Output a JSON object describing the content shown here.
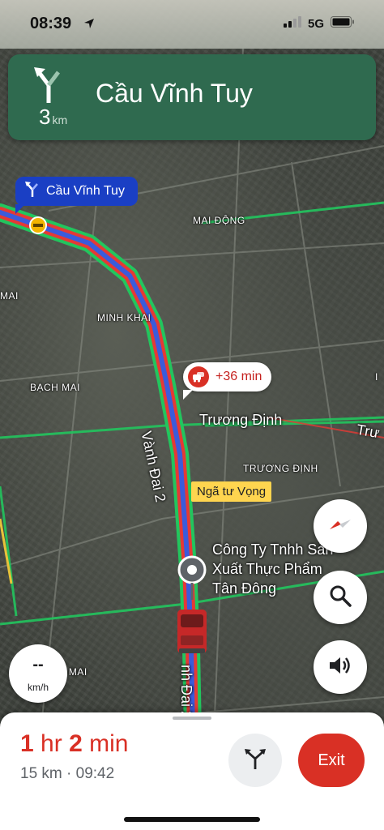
{
  "status_bar": {
    "time": "08:39",
    "network": "5G"
  },
  "direction_banner": {
    "distance_value": "3",
    "distance_unit": "km",
    "street": "Cầu Vĩnh Tuy",
    "color": "#2f6a4f"
  },
  "next_turn_callout": {
    "label": "Cầu Vĩnh Tuy",
    "color": "#1a3fc4"
  },
  "traffic_delay": {
    "label": "+36 min"
  },
  "map_labels": {
    "mai_dong": "MAI ĐỘNG",
    "minh_khai": "MINH KHAI",
    "bach_mai": "BẠCH MAI",
    "truong_dinh_district": "TRƯƠNG ĐỊNH",
    "mai_left": "MAI",
    "ng_mai": "NG MAI",
    "road_vanh_dai_2": "Vành Đai 2",
    "road_vanh_dai_2_lower": "nh Đai 2",
    "road_truong_dinh": "Trương Định",
    "road_tru_right": "Trư",
    "poi_line1": "Công Ty Tnhh Sản",
    "poi_line2": "Xuất Thực Phẩm",
    "poi_line3": "Tân Đông",
    "i_right": "I"
  },
  "intersection_label": "Ngã tư Vọng",
  "speedometer": {
    "value": "--",
    "unit": "km/h"
  },
  "bottom_sheet": {
    "duration_hr_num": "1",
    "duration_hr_unit": "hr",
    "duration_min_num": "2",
    "duration_min_unit": "min",
    "distance": "15 km",
    "separator": "·",
    "arrival": "09:42",
    "exit_label": "Exit"
  },
  "icons": {
    "turn": "turn-slight-left-icon",
    "compass": "compass-icon",
    "search": "search-icon",
    "sound": "volume-icon",
    "routes": "alternate-routes-icon",
    "car": "car-icon"
  },
  "colors": {
    "route_traffic_red": "#e53935",
    "route_blue": "#3b5bdb",
    "road_green": "#22c55e",
    "delay_red": "#d93025"
  }
}
